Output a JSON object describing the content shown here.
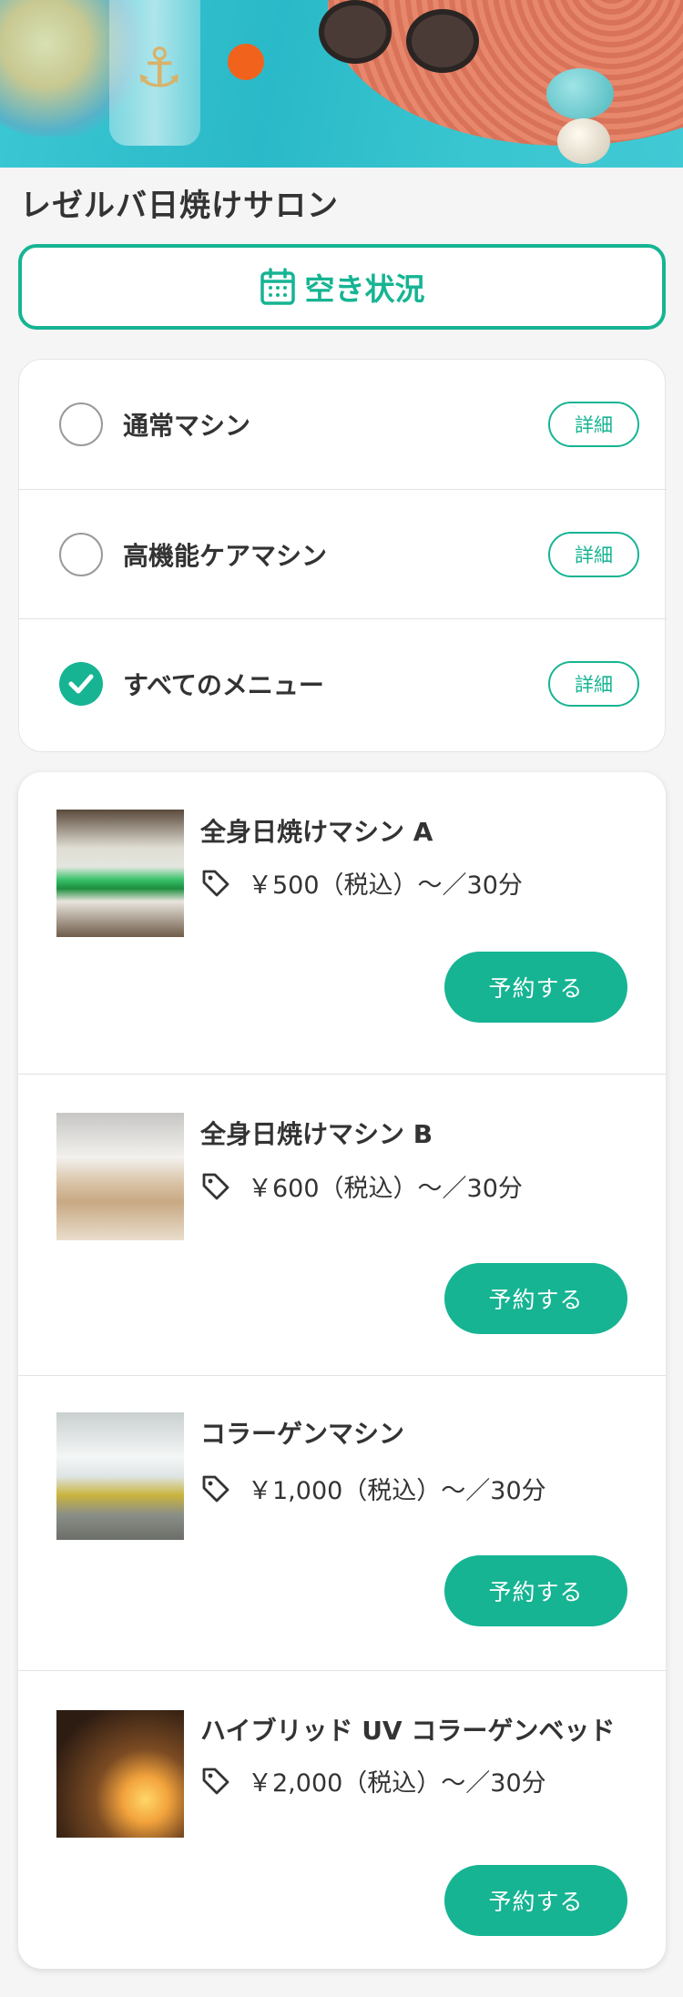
{
  "salon": {
    "name": "レゼルバ日焼けサロン"
  },
  "availability": {
    "label": "空き状況",
    "icon": "calendar-icon"
  },
  "menu_filter": {
    "detail_label": "詳細",
    "options": [
      {
        "label": "通常マシン",
        "checked": false
      },
      {
        "label": "高機能ケアマシン",
        "checked": false
      },
      {
        "label": "すべてのメニュー",
        "checked": true
      }
    ]
  },
  "machines": {
    "reserve_label": "予約する",
    "items": [
      {
        "name": "全身日焼けマシン A",
        "price": "￥500（税込）〜／30分"
      },
      {
        "name": "全身日焼けマシン B",
        "price": "￥600（税込）〜／30分"
      },
      {
        "name": "コラーゲンマシン",
        "price": "￥1,000（税込）〜／30分"
      },
      {
        "name": "ハイブリッド UV コラーゲンベッド",
        "price": "￥2,000（税込）〜／30分"
      }
    ]
  },
  "colors": {
    "accent": "#16b493"
  }
}
